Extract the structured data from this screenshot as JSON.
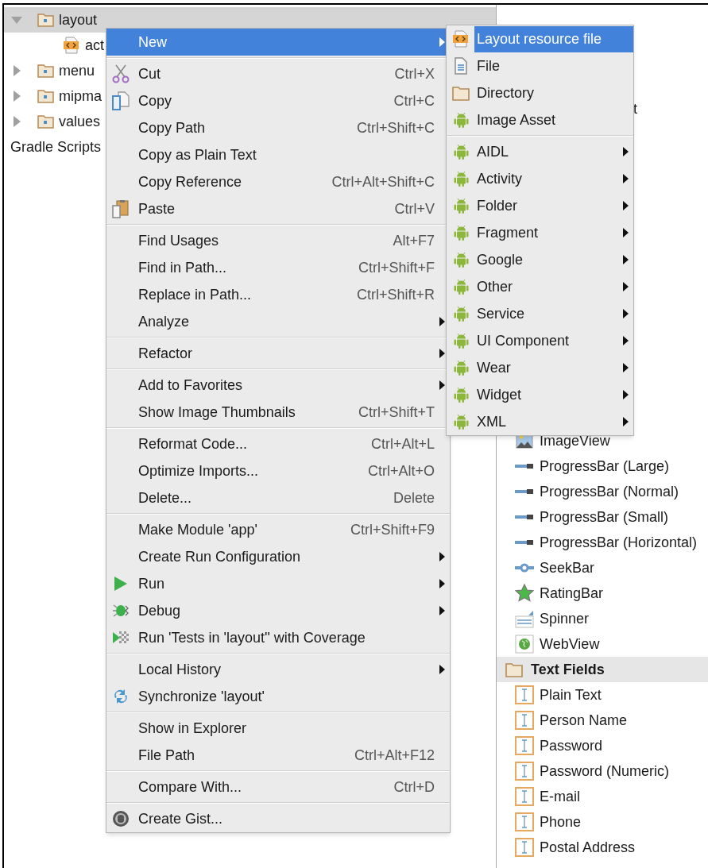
{
  "project_tree": {
    "items": [
      {
        "label": "layout",
        "kind": "folder",
        "expanded": true,
        "selected": true,
        "children": [
          {
            "label": "act",
            "kind": "layout-file",
            "selected": false
          }
        ]
      },
      {
        "label": "menu",
        "kind": "folder",
        "expanded": false,
        "selected": false
      },
      {
        "label": "mipma",
        "kind": "folder",
        "expanded": false,
        "selected": false
      },
      {
        "label": "values",
        "kind": "folder",
        "expanded": false,
        "selected": false
      },
      {
        "label": "Gradle Scripts",
        "kind": "plain",
        "selected": false
      }
    ]
  },
  "context_menu": {
    "groups": [
      [
        {
          "label": "New",
          "kind": "plain",
          "submenu": true,
          "selected": true
        }
      ],
      [
        {
          "label": "Cut",
          "kind": "scissors",
          "shortcut": "Ctrl+X",
          "selected": false
        },
        {
          "label": "Copy",
          "kind": "copy",
          "shortcut": "Ctrl+C",
          "selected": false
        },
        {
          "label": "Copy Path",
          "kind": "plain",
          "shortcut": "Ctrl+Shift+C",
          "selected": false
        },
        {
          "label": "Copy as Plain Text",
          "kind": "plain",
          "selected": false
        },
        {
          "label": "Copy Reference",
          "kind": "plain",
          "shortcut": "Ctrl+Alt+Shift+C",
          "selected": false
        },
        {
          "label": "Paste",
          "kind": "paste",
          "shortcut": "Ctrl+V",
          "selected": false
        }
      ],
      [
        {
          "label": "Find Usages",
          "kind": "plain",
          "shortcut": "Alt+F7",
          "selected": false
        },
        {
          "label": "Find in Path...",
          "kind": "plain",
          "shortcut": "Ctrl+Shift+F",
          "selected": false
        },
        {
          "label": "Replace in Path...",
          "kind": "plain",
          "shortcut": "Ctrl+Shift+R",
          "selected": false
        },
        {
          "label": "Analyze",
          "kind": "plain",
          "submenu": true,
          "selected": false
        }
      ],
      [
        {
          "label": "Refactor",
          "kind": "plain",
          "submenu": true,
          "selected": false
        }
      ],
      [
        {
          "label": "Add to Favorites",
          "kind": "plain",
          "submenu": true,
          "selected": false
        },
        {
          "label": "Show Image Thumbnails",
          "kind": "plain",
          "shortcut": "Ctrl+Shift+T",
          "selected": false
        }
      ],
      [
        {
          "label": "Reformat Code...",
          "kind": "plain",
          "shortcut": "Ctrl+Alt+L",
          "selected": false
        },
        {
          "label": "Optimize Imports...",
          "kind": "plain",
          "shortcut": "Ctrl+Alt+O",
          "selected": false
        },
        {
          "label": "Delete...",
          "kind": "plain",
          "shortcut": "Delete",
          "selected": false
        }
      ],
      [
        {
          "label": "Make Module 'app'",
          "kind": "plain",
          "shortcut": "Ctrl+Shift+F9",
          "selected": false
        },
        {
          "label": "Create Run Configuration",
          "kind": "plain",
          "submenu": true,
          "selected": false
        },
        {
          "label": "Run",
          "kind": "run",
          "submenu": true,
          "selected": false
        },
        {
          "label": "Debug",
          "kind": "debug",
          "submenu": true,
          "selected": false
        },
        {
          "label": "Run 'Tests in 'layout'' with Coverage",
          "kind": "coverage",
          "selected": false
        }
      ],
      [
        {
          "label": "Local History",
          "kind": "plain",
          "submenu": true,
          "selected": false
        },
        {
          "label": "Synchronize 'layout'",
          "kind": "sync",
          "selected": false
        }
      ],
      [
        {
          "label": "Show in Explorer",
          "kind": "plain",
          "selected": false
        },
        {
          "label": "File Path",
          "kind": "plain",
          "shortcut": "Ctrl+Alt+F12",
          "selected": false
        }
      ],
      [
        {
          "label": "Compare With...",
          "kind": "plain",
          "shortcut": "Ctrl+D",
          "selected": false
        }
      ],
      [
        {
          "label": "Create Gist...",
          "kind": "gist",
          "selected": false
        }
      ]
    ]
  },
  "new_submenu": {
    "groups": [
      [
        {
          "label": "Layout resource file",
          "kind": "layout-file",
          "selected": true
        },
        {
          "label": "File",
          "kind": "file",
          "selected": false
        },
        {
          "label": "Directory",
          "kind": "folder-plain",
          "selected": false
        },
        {
          "label": "Image Asset",
          "kind": "android",
          "selected": false
        }
      ],
      [
        {
          "label": "AIDL",
          "kind": "android",
          "submenu": true,
          "selected": false
        },
        {
          "label": "Activity",
          "kind": "android",
          "submenu": true,
          "selected": false
        },
        {
          "label": "Folder",
          "kind": "android",
          "submenu": true,
          "selected": false
        },
        {
          "label": "Fragment",
          "kind": "android",
          "submenu": true,
          "selected": false
        },
        {
          "label": "Google",
          "kind": "android",
          "submenu": true,
          "selected": false
        },
        {
          "label": "Other",
          "kind": "android",
          "submenu": true,
          "selected": false
        },
        {
          "label": "Service",
          "kind": "android",
          "submenu": true,
          "selected": false
        },
        {
          "label": "UI Component",
          "kind": "android",
          "submenu": true,
          "selected": false
        },
        {
          "label": "Wear",
          "kind": "android",
          "submenu": true,
          "selected": false
        },
        {
          "label": "Widget",
          "kind": "android",
          "submenu": true,
          "selected": false
        },
        {
          "label": "XML",
          "kind": "android",
          "submenu": true,
          "selected": false
        }
      ]
    ]
  },
  "palette": {
    "partial_text": "t",
    "items": [
      {
        "label": "ImageView",
        "kind": "image"
      },
      {
        "label": "ProgressBar (Large)",
        "kind": "progress"
      },
      {
        "label": "ProgressBar (Normal)",
        "kind": "progress"
      },
      {
        "label": "ProgressBar (Small)",
        "kind": "progress"
      },
      {
        "label": "ProgressBar (Horizontal)",
        "kind": "progress"
      },
      {
        "label": "SeekBar",
        "kind": "seekbar"
      },
      {
        "label": "RatingBar",
        "kind": "star"
      },
      {
        "label": "Spinner",
        "kind": "spinner"
      },
      {
        "label": "WebView",
        "kind": "web"
      }
    ],
    "section": {
      "label": "Text Fields",
      "kind": "folder-plain",
      "items": [
        {
          "label": "Plain Text",
          "kind": "textfield"
        },
        {
          "label": "Person Name",
          "kind": "textfield"
        },
        {
          "label": "Password",
          "kind": "textfield"
        },
        {
          "label": "Password (Numeric)",
          "kind": "textfield"
        },
        {
          "label": "E-mail",
          "kind": "textfield"
        },
        {
          "label": "Phone",
          "kind": "textfield"
        },
        {
          "label": "Postal Address",
          "kind": "textfield"
        }
      ]
    }
  }
}
